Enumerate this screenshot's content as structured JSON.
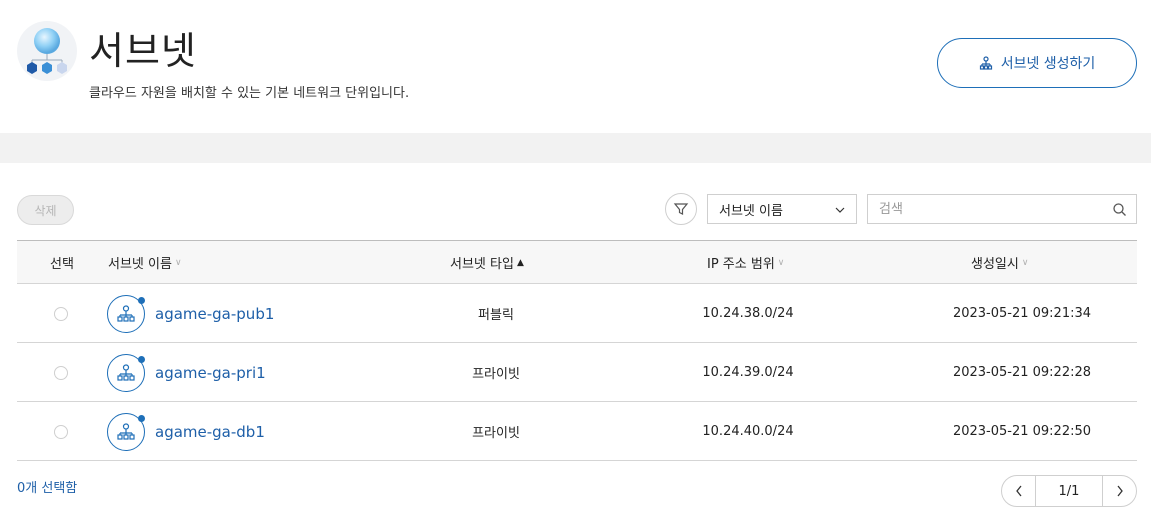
{
  "header": {
    "title": "서브넷",
    "subtitle": "클라우드 자원을 배치할 수 있는 기본 네트워크 단위입니다.",
    "create_button_label": "서브넷 생성하기"
  },
  "toolbar": {
    "delete_label": "삭제",
    "filter_select_value": "서브넷 이름",
    "search_placeholder": "검색"
  },
  "table": {
    "columns": {
      "select": "선택",
      "name": "서브넷 이름",
      "type": "서브넷 타입",
      "ip_range": "IP 주소 범위",
      "created": "생성일시"
    },
    "rows": [
      {
        "name": "agame-ga-pub1",
        "type": "퍼블릭",
        "ip_range": "10.24.38.0/24",
        "created": "2023-05-21 09:21:34"
      },
      {
        "name": "agame-ga-pri1",
        "type": "프라이빗",
        "ip_range": "10.24.39.0/24",
        "created": "2023-05-21 09:22:28"
      },
      {
        "name": "agame-ga-db1",
        "type": "프라이빗",
        "ip_range": "10.24.40.0/24",
        "created": "2023-05-21 09:22:50"
      }
    ]
  },
  "footer": {
    "selected_count": "0개 선택함",
    "page_info": "1/1"
  },
  "colors": {
    "accent": "#1e6fb8",
    "link": "#1e5fa8",
    "band": "#f2f2f2"
  },
  "icons": {
    "logo": "network-cubes-logo",
    "create": "hierarchy-icon",
    "filter": "funnel-icon",
    "select": "chevron-down-icon",
    "search": "search-icon",
    "row": "subnet-hierarchy-icon",
    "prev": "chevron-left-icon",
    "next": "chevron-right-icon"
  }
}
